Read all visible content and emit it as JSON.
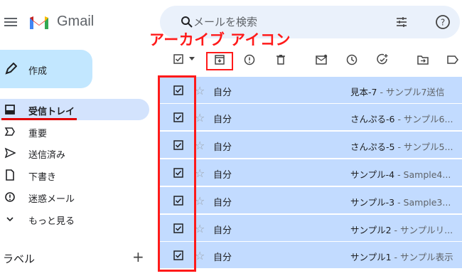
{
  "app": {
    "brand": "Gmail",
    "icons": {
      "menu": "menu-icon",
      "logo": "gmail-logo-icon"
    }
  },
  "search": {
    "placeholder": "メールを検索",
    "icons": [
      "search-icon",
      "tune-icon",
      "help-icon"
    ]
  },
  "compose": {
    "label": "作成",
    "icon": "pencil-icon"
  },
  "sidebar": {
    "items": [
      {
        "label": "受信トレイ",
        "icon": "inbox-icon",
        "active": true
      },
      {
        "label": "重要",
        "icon": "label-important-icon"
      },
      {
        "label": "送信済み",
        "icon": "send-icon"
      },
      {
        "label": "下書き",
        "icon": "draft-icon"
      },
      {
        "label": "迷惑メール",
        "icon": "spam-icon"
      },
      {
        "label": "もっと見る",
        "icon": "chevron-down-icon"
      }
    ],
    "labels_title": "ラベル",
    "labels_add": "+"
  },
  "toolbar": {
    "icons": [
      "select-all-checkbox",
      "archive-icon",
      "report-spam-icon",
      "delete-icon",
      "mark-unread-icon",
      "snooze-icon",
      "add-task-icon",
      "move-to-icon",
      "label-icon"
    ]
  },
  "annotation": {
    "title": "アーカイブ アイコン",
    "color": "#ff1a1a"
  },
  "emails": [
    {
      "sender": "自分",
      "subject": "見本-7",
      "snippet": " - サンプル7送信"
    },
    {
      "sender": "自分",
      "subject": "さんぷる-6",
      "snippet": " - サンプル6..."
    },
    {
      "sender": "自分",
      "subject": "さんぷる-5",
      "snippet": " - サンプル5..."
    },
    {
      "sender": "自分",
      "subject": "サンプル-4",
      "snippet": " - Sample4..."
    },
    {
      "sender": "自分",
      "subject": "サンプル-3",
      "snippet": " - Sample3..."
    },
    {
      "sender": "自分",
      "subject": "サンプル2",
      "snippet": " - サンプルリ..."
    },
    {
      "sender": "自分",
      "subject": "サンプル1",
      "snippet": " - サンプル表示"
    }
  ],
  "colors": {
    "selected_row": "#c2dbff",
    "active_nav": "#d3e3fd",
    "compose": "#c2e7ff",
    "search_bg": "#eaf1fb"
  }
}
